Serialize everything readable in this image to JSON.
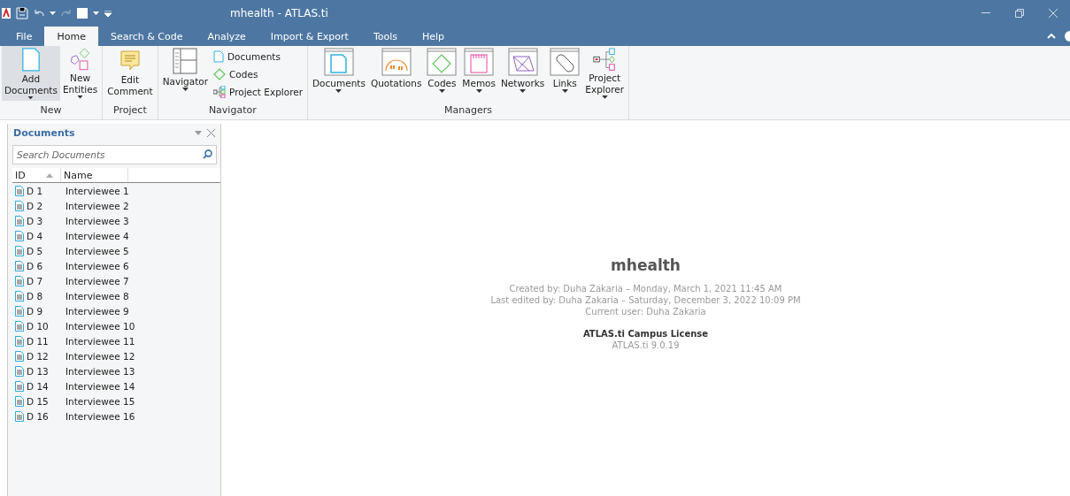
{
  "window": {
    "title": "mhealth - ATLAS.ti"
  },
  "tabs": [
    {
      "label": "File",
      "selected": false
    },
    {
      "label": "Home",
      "selected": true
    },
    {
      "label": "Search & Code",
      "selected": false
    },
    {
      "label": "Analyze",
      "selected": false
    },
    {
      "label": "Import & Export",
      "selected": false
    },
    {
      "label": "Tools",
      "selected": false
    },
    {
      "label": "Help",
      "selected": false
    }
  ],
  "ribbon": [
    {
      "name": "New",
      "items": [
        {
          "kind": "large",
          "label": "Add\nDocuments",
          "dropdown": true,
          "highlighted": true
        },
        {
          "kind": "large",
          "label": "New\nEntities",
          "dropdown": true,
          "highlighted": false
        }
      ]
    },
    {
      "name": "Project",
      "items": [
        {
          "kind": "large",
          "label": "Edit\nComment",
          "dropdown": false,
          "highlighted": false
        }
      ]
    },
    {
      "name": "Navigator",
      "items": [
        {
          "kind": "large",
          "label": "Navigator",
          "dropdown": true,
          "highlighted": false
        },
        {
          "kind": "small-list",
          "entries": [
            {
              "label": "Documents"
            },
            {
              "label": "Codes"
            },
            {
              "label": "Project Explorer"
            }
          ]
        }
      ]
    },
    {
      "name": "Managers",
      "items": [
        {
          "kind": "large",
          "label": "Documents",
          "dropdown": true,
          "highlighted": false
        },
        {
          "kind": "large",
          "label": "Quotations",
          "dropdown": false,
          "highlighted": false
        },
        {
          "kind": "large",
          "label": "Codes",
          "dropdown": true,
          "highlighted": false
        },
        {
          "kind": "large",
          "label": "Memos",
          "dropdown": true,
          "highlighted": false
        },
        {
          "kind": "large",
          "label": "Networks",
          "dropdown": true,
          "highlighted": false
        },
        {
          "kind": "large",
          "label": "Links",
          "dropdown": true,
          "highlighted": false
        },
        {
          "kind": "large",
          "label": "Project\nExplorer",
          "dropdown": true,
          "highlighted": false
        }
      ]
    }
  ],
  "documents_panel": {
    "title": "Documents",
    "search": {
      "placeholder": "Search Documents"
    },
    "columns": [
      "ID",
      "Name"
    ],
    "rows": [
      {
        "id": "D 1",
        "name": "Interviewee 1"
      },
      {
        "id": "D 2",
        "name": "Interviewee 2"
      },
      {
        "id": "D 3",
        "name": "Interviewee 3"
      },
      {
        "id": "D 4",
        "name": "Interviewee 4"
      },
      {
        "id": "D 5",
        "name": "Interviewee 5"
      },
      {
        "id": "D 6",
        "name": "Interviewee 6"
      },
      {
        "id": "D 7",
        "name": "Interviewee 7"
      },
      {
        "id": "D 8",
        "name": "Interviewee 8"
      },
      {
        "id": "D 9",
        "name": "Interviewee 9"
      },
      {
        "id": "D 10",
        "name": "Interviewee 10"
      },
      {
        "id": "D 11",
        "name": "Interviewee 11"
      },
      {
        "id": "D 12",
        "name": "Interviewee 12"
      },
      {
        "id": "D 13",
        "name": "Interviewee 13"
      },
      {
        "id": "D 14",
        "name": "Interviewee 14"
      },
      {
        "id": "D 15",
        "name": "Interviewee 15"
      },
      {
        "id": "D 16",
        "name": "Interviewee 16"
      }
    ]
  },
  "project_info": {
    "title": "mhealth",
    "lines": [
      "Created by: Duha Zakaria – Monday, March 1, 2021 11:45 AM",
      "Last edited by: Duha Zakaria – Saturday, December 3, 2022 10:09 PM",
      "Current user: Duha Zakaria"
    ],
    "license": "ATLAS.ti Campus License",
    "version": "ATLAS.ti 9.0.19"
  }
}
